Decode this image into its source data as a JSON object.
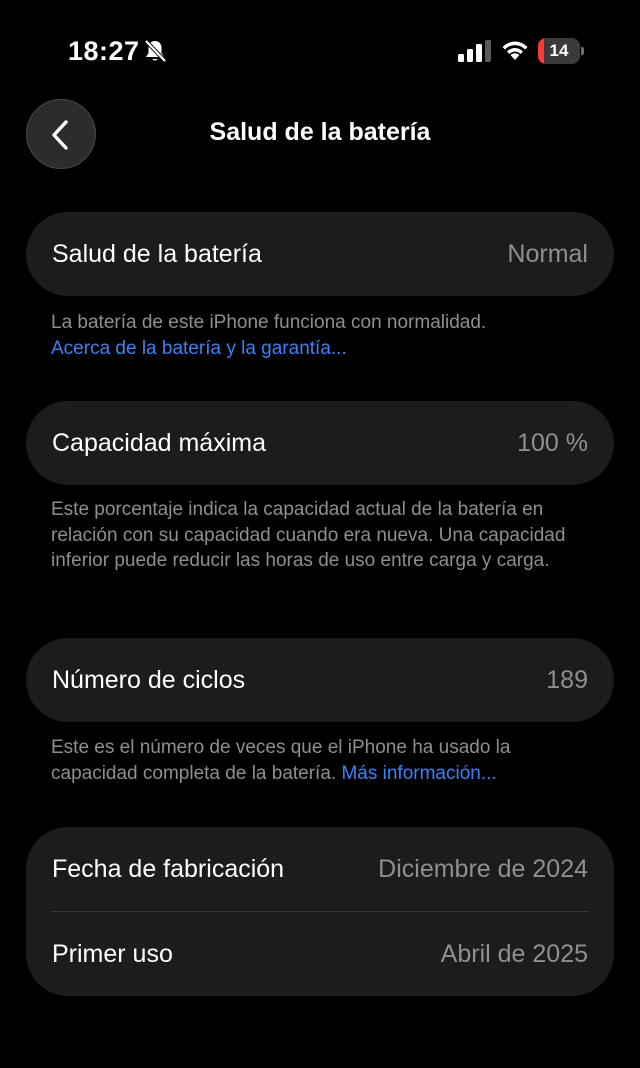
{
  "status_bar": {
    "time": "18:27",
    "battery_level": "14",
    "battery_fraction": 0.14,
    "icons": [
      "bell-slash-icon",
      "cellular-signal-icon",
      "wifi-icon",
      "battery-icon"
    ]
  },
  "nav": {
    "title": "Salud de la batería",
    "back_icon": "chevron-left-icon"
  },
  "battery_health": {
    "label": "Salud de la batería",
    "value": "Normal",
    "note": "La batería de este iPhone funciona con normalidad.",
    "link": "Acerca de la batería y la garantía..."
  },
  "max_capacity": {
    "label": "Capacidad máxima",
    "value": "100 %",
    "note": "Este porcentaje indica la capacidad actual de la batería en relación con su capacidad cuando era nueva. Una capacidad inferior puede reducir las horas de uso entre carga y carga."
  },
  "cycle_count": {
    "label": "Número de ciclos",
    "value": "189",
    "note": "Este es el número de veces que el iPhone ha usado la capacidad completa de la batería.",
    "link": "Más información..."
  },
  "dates": {
    "manufacture_label": "Fecha de fabricación",
    "manufacture_value": "Diciembre de 2024",
    "first_use_label": "Primer uso",
    "first_use_value": "Abril de 2025"
  },
  "colors": {
    "background": "#000000",
    "card": "#1c1c1e",
    "secondary_text": "#8e8e93",
    "link": "#3b82f6",
    "battery_low": "#ff3b30"
  }
}
